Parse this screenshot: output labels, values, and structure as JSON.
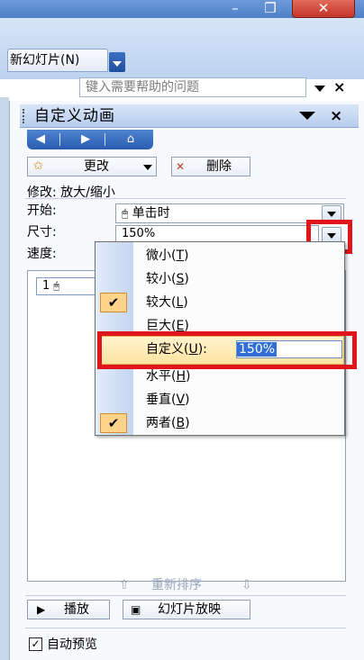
{
  "window": {
    "minimize": "–",
    "maximize": "❐",
    "close": "✕"
  },
  "toolbar": {
    "new_slide_label": "新幻灯片(N)",
    "help_placeholder": "键入需要帮助的问题",
    "help_close": "×"
  },
  "pane": {
    "title": "自定义动画",
    "close": "×",
    "nav": {
      "back_icon": "back-circle-icon",
      "forward_icon": "forward-circle-icon",
      "home_icon": "home-icon"
    },
    "change_label": "更改",
    "delete_label": "删除",
    "modify_label": "修改: 放大/缩小",
    "start_label": "开始:",
    "start_value": "单击时",
    "size_label": "尺寸:",
    "size_value": "150%",
    "speed_label": "速度:",
    "list_item": "1",
    "reorder_label": "重新排序",
    "play_label": "播放",
    "slideshow_label": "幻灯片放映",
    "autopreview_label": "自动预览",
    "autopreview_checked": true
  },
  "size_menu": {
    "items": [
      {
        "label": "微小(",
        "key": "T",
        "suffix": ")",
        "checked": false
      },
      {
        "label": "较小(",
        "key": "S",
        "suffix": ")",
        "checked": false
      },
      {
        "label": "较大(",
        "key": "L",
        "suffix": ")",
        "checked": true
      },
      {
        "label": "巨大(",
        "key": "E",
        "suffix": ")",
        "checked": false
      }
    ],
    "custom_label": "自定义(",
    "custom_key": "U",
    "custom_suffix": "):",
    "custom_value": "150%",
    "items2": [
      {
        "label": "水平(",
        "key": "H",
        "suffix": ")",
        "checked": false
      },
      {
        "label": "垂直(",
        "key": "V",
        "suffix": ")",
        "checked": false
      },
      {
        "label": "两者(",
        "key": "B",
        "suffix": ")",
        "checked": true
      }
    ]
  },
  "colors": {
    "highlight_box": "#e0141a",
    "menu_check": "#ffd38a",
    "pane_header": "#b7cdee"
  }
}
